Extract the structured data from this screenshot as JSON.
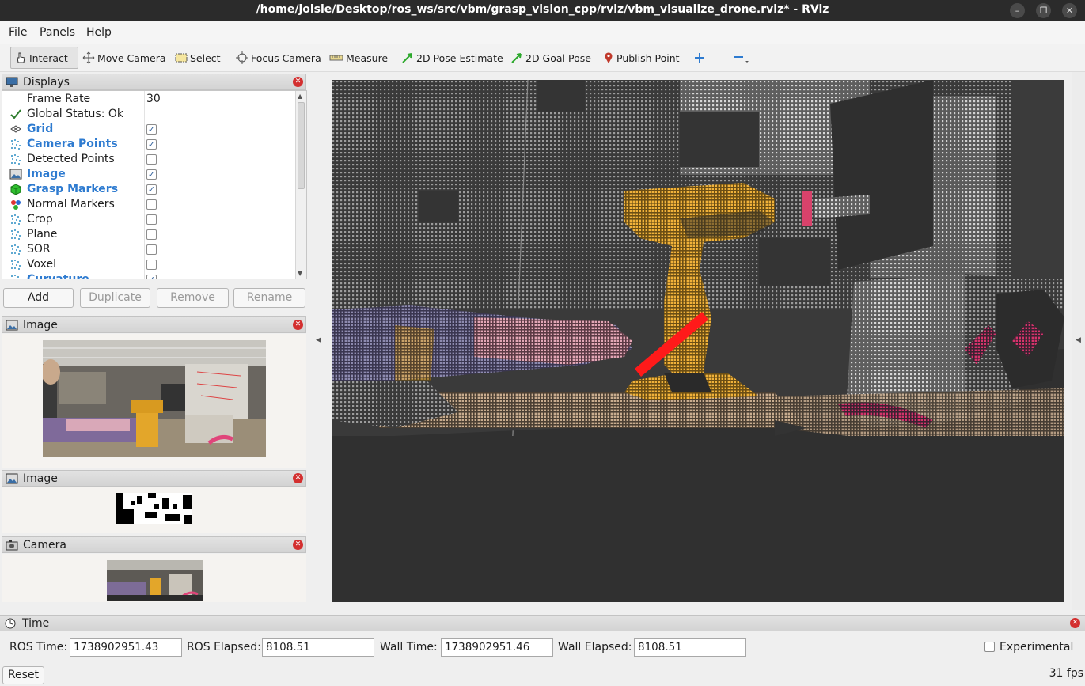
{
  "window": {
    "title": "/home/joisie/Desktop/ros_ws/src/vbm/grasp_vision_cpp/rviz/vbm_visualize_drone.rviz* - RViz"
  },
  "menu": [
    {
      "label": "File"
    },
    {
      "label": "Panels"
    },
    {
      "label": "Help"
    }
  ],
  "toolbar": {
    "interact": "Interact",
    "move_camera": "Move Camera",
    "select": "Select",
    "focus_camera": "Focus Camera",
    "measure": "Measure",
    "pose_estimate": "2D Pose Estimate",
    "goal_pose": "2D Goal Pose",
    "publish_point": "Publish Point"
  },
  "displays": {
    "title": "Displays",
    "rows": [
      {
        "label": "Frame Rate",
        "value": "30"
      },
      {
        "label": "Global Status: Ok",
        "icon": "checkmark-icon"
      },
      {
        "label": "Grid",
        "checked": true,
        "highlight": true,
        "icon": "grid-icon"
      },
      {
        "label": "Camera Points",
        "checked": true,
        "highlight": true,
        "icon": "pointcloud-icon"
      },
      {
        "label": "Detected Points",
        "checked": false,
        "highlight": false,
        "icon": "pointcloud-icon"
      },
      {
        "label": "Image",
        "checked": true,
        "highlight": true,
        "icon": "image-icon"
      },
      {
        "label": "Grasp Markers",
        "checked": true,
        "highlight": true,
        "icon": "marker-cube-icon"
      },
      {
        "label": "Normal Markers",
        "checked": false,
        "highlight": false,
        "icon": "markers-icon"
      },
      {
        "label": "Crop",
        "checked": false,
        "highlight": false,
        "icon": "pointcloud-icon"
      },
      {
        "label": "Plane",
        "checked": false,
        "highlight": false,
        "icon": "pointcloud-icon"
      },
      {
        "label": "SOR",
        "checked": false,
        "highlight": false,
        "icon": "pointcloud-icon"
      },
      {
        "label": "Voxel",
        "checked": false,
        "highlight": false,
        "icon": "pointcloud-icon"
      },
      {
        "label": "Curvature",
        "checked": true,
        "highlight": true,
        "icon": "pointcloud-icon"
      }
    ],
    "buttons": {
      "add": "Add",
      "duplicate": "Duplicate",
      "remove": "Remove",
      "rename": "Rename"
    }
  },
  "panels": {
    "image1": "Image",
    "image2": "Image",
    "camera": "Camera"
  },
  "time": {
    "title": "Time",
    "ros_time_label": "ROS Time:",
    "ros_time": "1738902951.43",
    "ros_elapsed_label": "ROS Elapsed:",
    "ros_elapsed": "8108.51",
    "wall_time_label": "Wall Time:",
    "wall_time": "1738902951.46",
    "wall_elapsed_label": "Wall Elapsed:",
    "wall_elapsed": "8108.51",
    "experimental": "Experimental",
    "reset": "Reset",
    "fps": "31 fps"
  },
  "colors": {
    "highlight_text": "#2e7bd0",
    "close_button": "#d32f2f",
    "viewport_bg": "#303030",
    "drill_yellow": "#e8a92c",
    "grasp_red": "#ff1a1a"
  }
}
